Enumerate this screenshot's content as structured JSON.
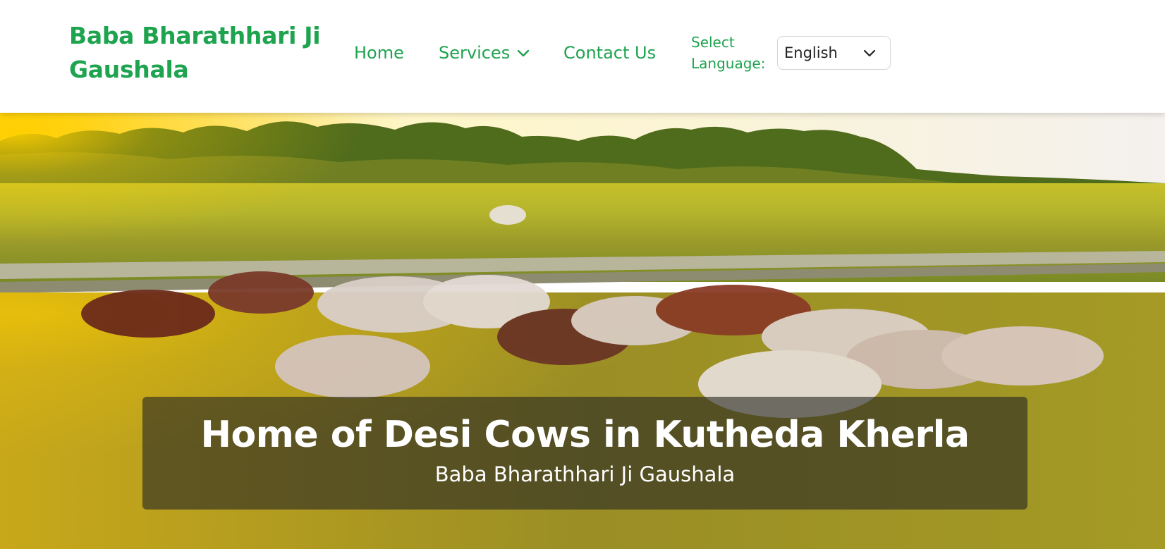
{
  "header": {
    "brand_line1": "Baba Bharathhari Ji",
    "brand_line2": "Gaushala",
    "nav": {
      "home": "Home",
      "services": "Services",
      "contact": "Contact Us"
    },
    "language_label_line1": "Select",
    "language_label_line2": "Language:",
    "language_selected": "English"
  },
  "hero": {
    "title": "Home of Desi Cows in Kutheda Kherla",
    "subtitle": "Baba Bharathhari Ji Gaushala"
  },
  "colors": {
    "brand_green": "#1ea34f",
    "caption_overlay": "rgba(40,40,35,0.62)"
  },
  "icons": {
    "services_dropdown": "chevron-down-icon",
    "language_dropdown": "chevron-down-icon"
  }
}
